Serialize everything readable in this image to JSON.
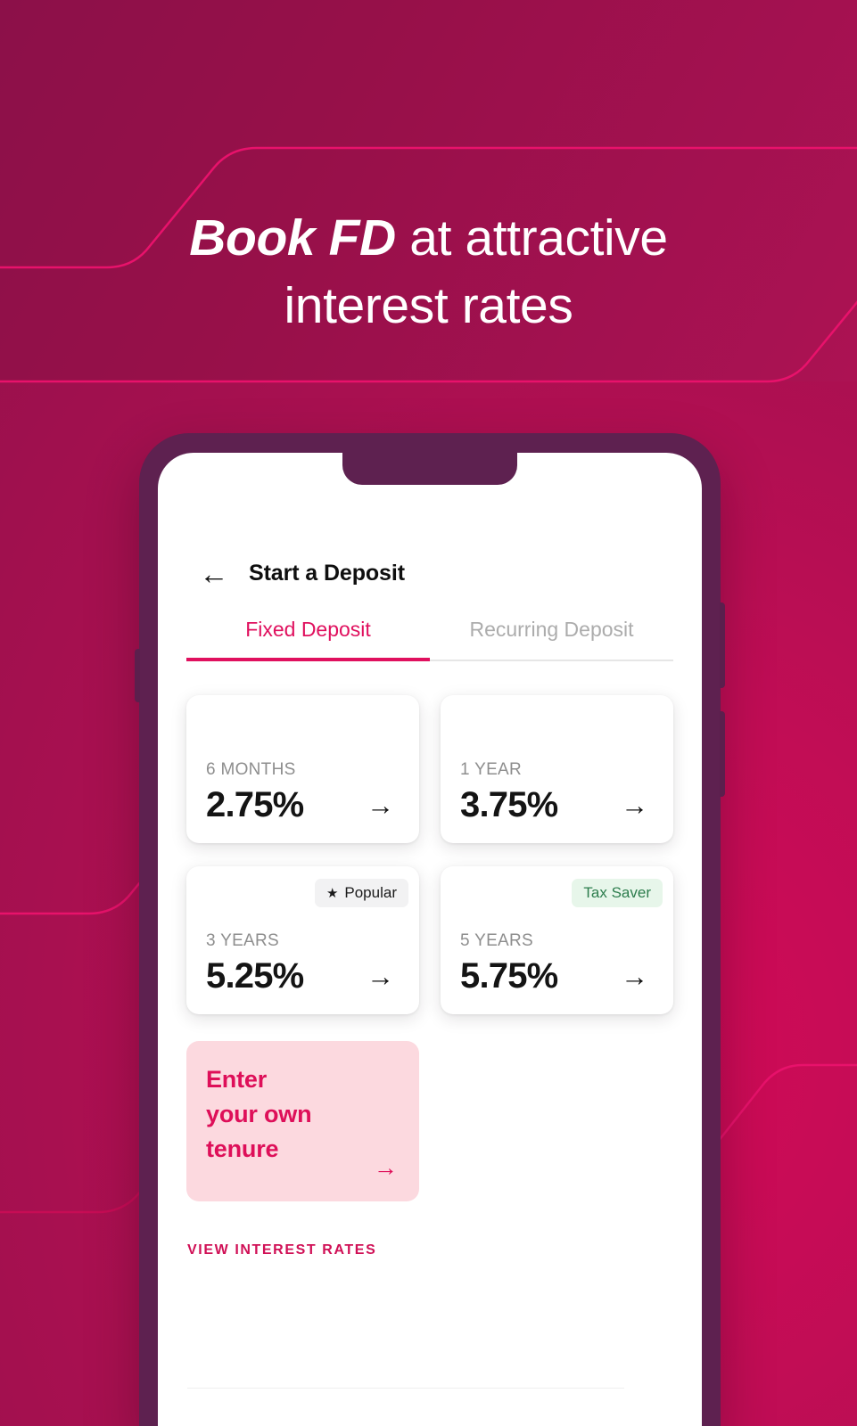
{
  "promo": {
    "headline_strong": "Book FD",
    "headline_rest": " at attractive",
    "headline_line2": "interest rates",
    "background_color": "#9C0F50",
    "accent_line_color": "#E8126B"
  },
  "phone": {
    "bezel_color": "#5E2150",
    "screen_background": "#FFFFFF"
  },
  "app": {
    "back_icon": "←",
    "title": "Start a Deposit",
    "tabs": [
      {
        "label": "Fixed Deposit",
        "active": true,
        "color": "#E0105E"
      },
      {
        "label": "Recurring Deposit",
        "active": false,
        "color": "#ACACAC"
      }
    ],
    "cards": [
      {
        "term": "6 MONTHS",
        "rate": "2.75%",
        "arrow": "→",
        "badge": null
      },
      {
        "term": "1 YEAR",
        "rate": "3.75%",
        "arrow": "→",
        "badge": null
      },
      {
        "term": "3 YEARS",
        "rate": "5.25%",
        "arrow": "→",
        "badge": {
          "label": "Popular",
          "icon": "★",
          "style": "popular",
          "bg": "#F2F2F3",
          "fg": "#1B1B1B"
        }
      },
      {
        "term": "5 YEARS",
        "rate": "5.75%",
        "arrow": "→",
        "badge": {
          "label": "Tax Saver",
          "icon": "",
          "style": "tax",
          "bg": "#E7F6EA",
          "fg": "#2D7D4D"
        }
      }
    ],
    "custom_tenure": {
      "line1": "Enter",
      "line2": "your own",
      "line3": "tenure",
      "arrow": "→",
      "background": "#FCD9DF",
      "text_color": "#DE0F59"
    },
    "view_rates_link": "VIEW INTEREST RATES"
  }
}
